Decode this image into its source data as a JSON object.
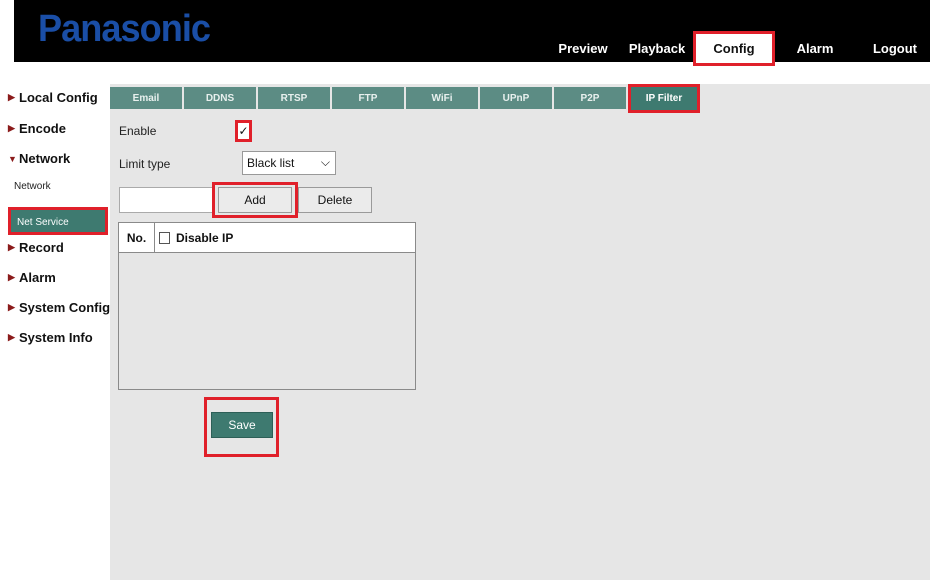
{
  "brand": "Panasonic",
  "top_nav": {
    "preview": "Preview",
    "playback": "Playback",
    "config": "Config",
    "alarm": "Alarm",
    "logout": "Logout"
  },
  "sidebar": {
    "local_config": "Local Config",
    "encode": "Encode",
    "network": "Network",
    "network_sub": "Network",
    "net_service": "Net Service",
    "record": "Record",
    "alarm": "Alarm",
    "system_config": "System Config",
    "system_info": "System Info"
  },
  "tabs": [
    "Email",
    "DDNS",
    "RTSP",
    "FTP",
    "WiFi",
    "UPnP",
    "P2P",
    "IP Filter"
  ],
  "form": {
    "enable_label": "Enable",
    "enable_checked": true,
    "limit_type_label": "Limit type",
    "limit_type_value": "Black list",
    "ip_value": "",
    "add_label": "Add",
    "delete_label": "Delete",
    "col_no": "No.",
    "col_disable_ip": "Disable IP",
    "save_label": "Save"
  },
  "colors": {
    "accent_teal": "#3e7a70",
    "highlight_red": "#e0202a",
    "brand_blue": "#1a4ea6"
  }
}
